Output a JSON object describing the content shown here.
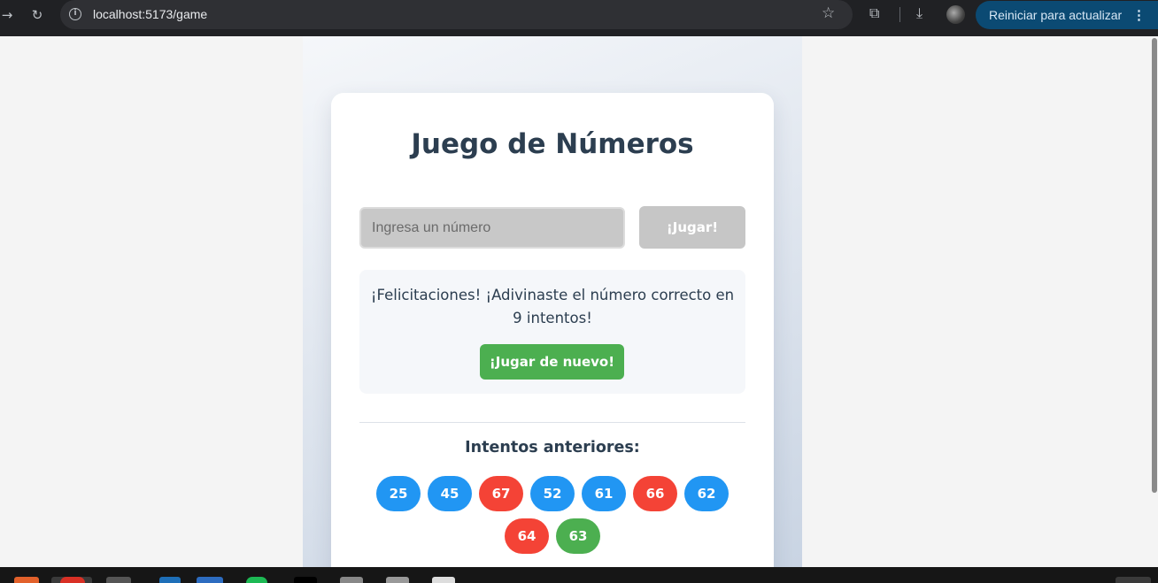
{
  "browser": {
    "url": "localhost:5173/game",
    "update_button": "Reiniciar para actualizar"
  },
  "game": {
    "title": "Juego de Números",
    "input_placeholder": "Ingresa un número",
    "play_button": "¡Jugar!",
    "success_message": "¡Felicitaciones! ¡Adivinaste el número correcto en 9 intentos!",
    "play_again_button": "¡Jugar de nuevo!",
    "history_title": "Intentos anteriores:",
    "attempts": [
      {
        "value": "25",
        "status": "low",
        "color": "#2196f3"
      },
      {
        "value": "45",
        "status": "low",
        "color": "#2196f3"
      },
      {
        "value": "67",
        "status": "high",
        "color": "#f44336"
      },
      {
        "value": "52",
        "status": "low",
        "color": "#2196f3"
      },
      {
        "value": "61",
        "status": "low",
        "color": "#2196f3"
      },
      {
        "value": "66",
        "status": "high",
        "color": "#f44336"
      },
      {
        "value": "62",
        "status": "low",
        "color": "#2196f3"
      },
      {
        "value": "64",
        "status": "high",
        "color": "#f44336"
      },
      {
        "value": "63",
        "status": "correct",
        "color": "#4caf50"
      }
    ]
  },
  "colors": {
    "title": "#2c3e50",
    "success": "#4caf50",
    "too_low": "#2196f3",
    "too_high": "#f44336"
  }
}
